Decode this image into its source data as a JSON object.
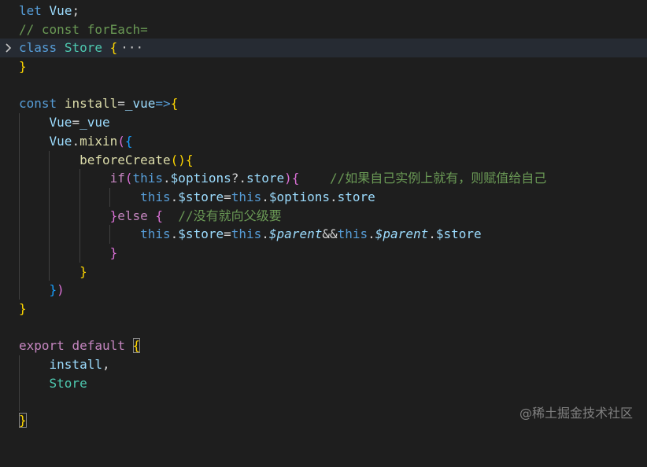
{
  "editor": {
    "language": "javascript",
    "lines": [
      "let Vue;",
      "// const forEach=",
      "class Store {···",
      "}",
      "",
      "const install=_vue=>{",
      "    Vue=_vue",
      "    Vue.mixin({",
      "        beforeCreate(){",
      "            if(this.$options?.store){    //如果自己实例上就有，则赋值给自己",
      "                this.$store=this.$options.store",
      "            }else {  //没有就向父级要",
      "                this.$store=this.$parent&&this.$parent.$store",
      "            }",
      "        }",
      "    })",
      "}",
      "",
      "export default {",
      "    install,",
      "    Store",
      "",
      "}"
    ],
    "comments": {
      "forEach": "// const forEach=",
      "self_instance": "//如果自己实例上就有，则赋值给自己",
      "parent": "//没有就向父级要"
    },
    "folded_marker": "···",
    "folded_line": 3,
    "theme": {
      "background": "#1e1e1e",
      "current_line": "#262b33",
      "keyword": "#569cd6",
      "control": "#c586c0",
      "variable": "#9cdcfe",
      "class": "#4ec9b0",
      "function": "#dcdcaa",
      "comment": "#6a9955",
      "bracket_1": "#ffd700",
      "bracket_2": "#da70d6",
      "bracket_3": "#179fff"
    }
  },
  "watermark": "@稀土掘金技术社区",
  "icons": {
    "fold": "chevron-right-icon"
  }
}
